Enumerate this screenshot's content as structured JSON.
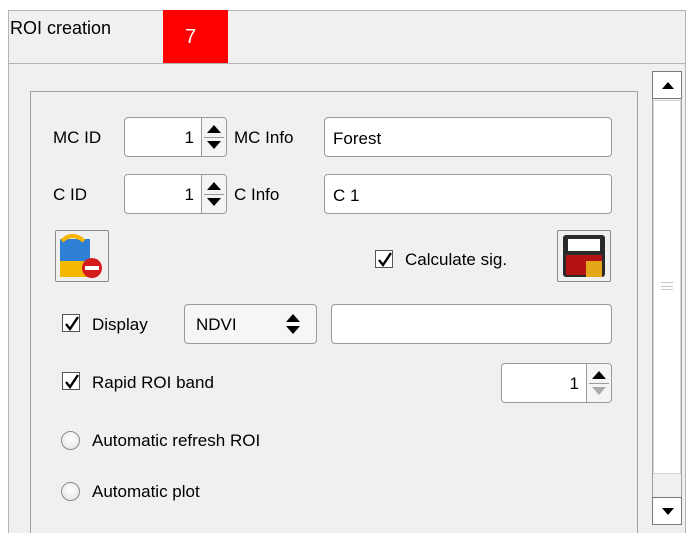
{
  "header": {
    "title": "ROI creation",
    "badge": "7"
  },
  "form": {
    "mc_id": {
      "label": "MC ID",
      "value": "1"
    },
    "mc_info": {
      "label": "MC Info",
      "value": "Forest"
    },
    "c_id": {
      "label": "C ID",
      "value": "1"
    },
    "c_info": {
      "label": "C Info",
      "value": "C 1"
    },
    "calculate_sig": {
      "label": "Calculate sig.",
      "checked": true
    },
    "display": {
      "label": "Display",
      "checked": true,
      "select_value": "NDVI",
      "text_value": ""
    },
    "rapid_roi_band": {
      "label": "Rapid ROI band",
      "checked": true,
      "value": "1"
    },
    "automatic_refresh_roi": {
      "label": "Automatic refresh ROI",
      "selected": false
    },
    "automatic_plot": {
      "label": "Automatic  plot",
      "selected": false
    }
  },
  "icons": {
    "undo_roi": "undo-roi-icon",
    "save_signature": "save-signature-icon"
  },
  "colors": {
    "badge": "#ff0000",
    "panel": "#f0f0f0"
  }
}
